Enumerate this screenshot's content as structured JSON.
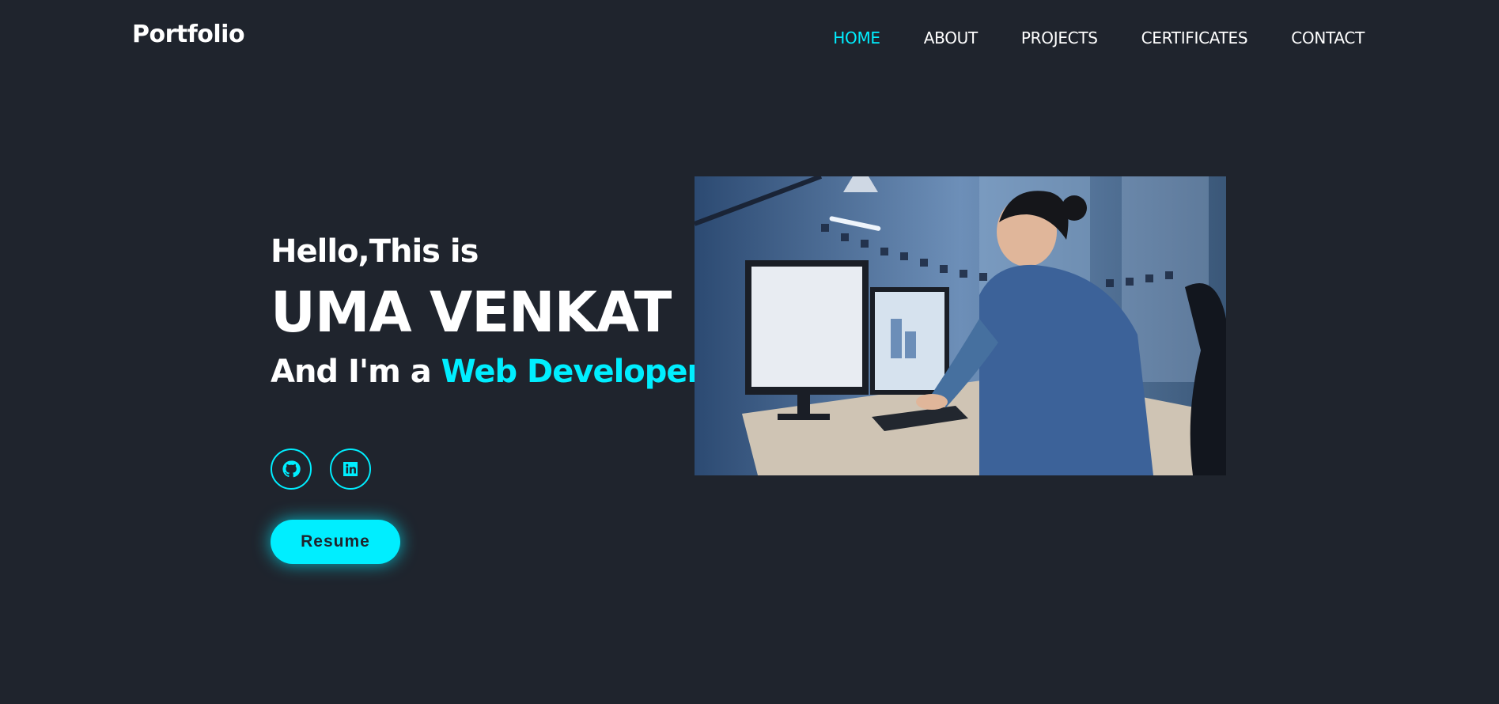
{
  "nav": {
    "logo": "Portfolio",
    "links": [
      {
        "label": "HOME",
        "active": true
      },
      {
        "label": "ABOUT",
        "active": false
      },
      {
        "label": "PROJECTS",
        "active": false
      },
      {
        "label": "CERTIFICATES",
        "active": false
      },
      {
        "label": "CONTACT",
        "active": false
      }
    ]
  },
  "hero": {
    "greeting": "Hello,This is",
    "name": "UMA VENKAT",
    "role_prefix": "And I'm a",
    "role_highlight": "Web Developer",
    "socials": [
      {
        "icon": "github-icon"
      },
      {
        "icon": "linkedin-icon"
      }
    ],
    "resume_label": "Resume"
  },
  "colors": {
    "background": "#1f242d",
    "accent": "#00eeff",
    "text": "#ffffff"
  }
}
